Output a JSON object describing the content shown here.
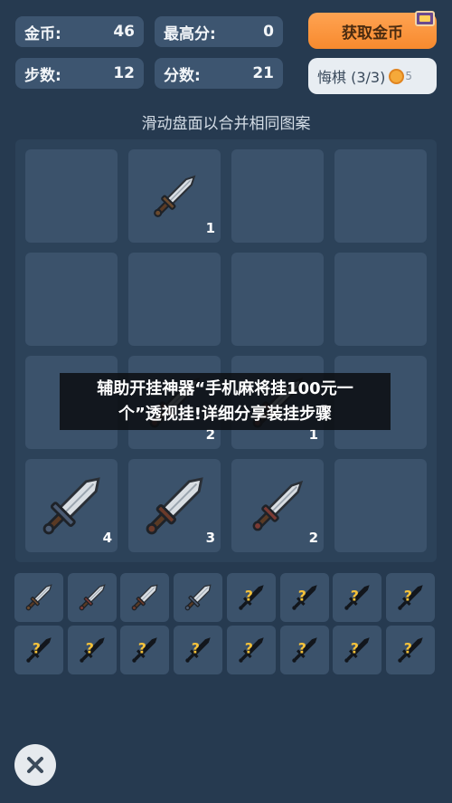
{
  "stats": {
    "coins_label": "金币:",
    "coins_value": "46",
    "best_label": "最高分:",
    "best_value": "0",
    "steps_label": "步数:",
    "steps_value": "12",
    "score_label": "分数:",
    "score_value": "21"
  },
  "buttons": {
    "get_coins": "获取金币",
    "undo": "悔棋 (3/3)",
    "undo_cost": "5"
  },
  "hint": "滑动盘面以合并相同图案",
  "board": {
    "rows": [
      [
        null,
        {
          "level": 1,
          "count": "1"
        },
        null,
        null
      ],
      [
        null,
        null,
        null,
        null
      ],
      [
        null,
        {
          "level": 2,
          "count": "2"
        },
        {
          "level": 2,
          "count": "1"
        },
        null
      ],
      [
        {
          "level": 4,
          "count": "4"
        },
        {
          "level": 3,
          "count": "3"
        },
        {
          "level": 2,
          "count": "2"
        },
        null
      ]
    ]
  },
  "collection": {
    "slots": [
      "unlocked",
      "unlocked",
      "unlocked",
      "unlocked",
      "locked",
      "locked",
      "locked",
      "locked",
      "locked",
      "locked",
      "locked",
      "locked",
      "locked",
      "locked",
      "locked",
      "locked"
    ]
  },
  "overlay": {
    "line1": "辅助开挂神器“手机麻将挂100元一",
    "line2": "个”透视挂!详细分享装挂步骤"
  },
  "icons": {
    "close": "close-icon",
    "tv": "tv-ad-icon",
    "coin": "coin-icon",
    "sword": "sword-icon",
    "question": "question-mark-icon"
  },
  "colors": {
    "background": "#263a50",
    "tile": "#3b526b",
    "accent_orange": "#f78a2e",
    "question": "#f5c23a"
  }
}
